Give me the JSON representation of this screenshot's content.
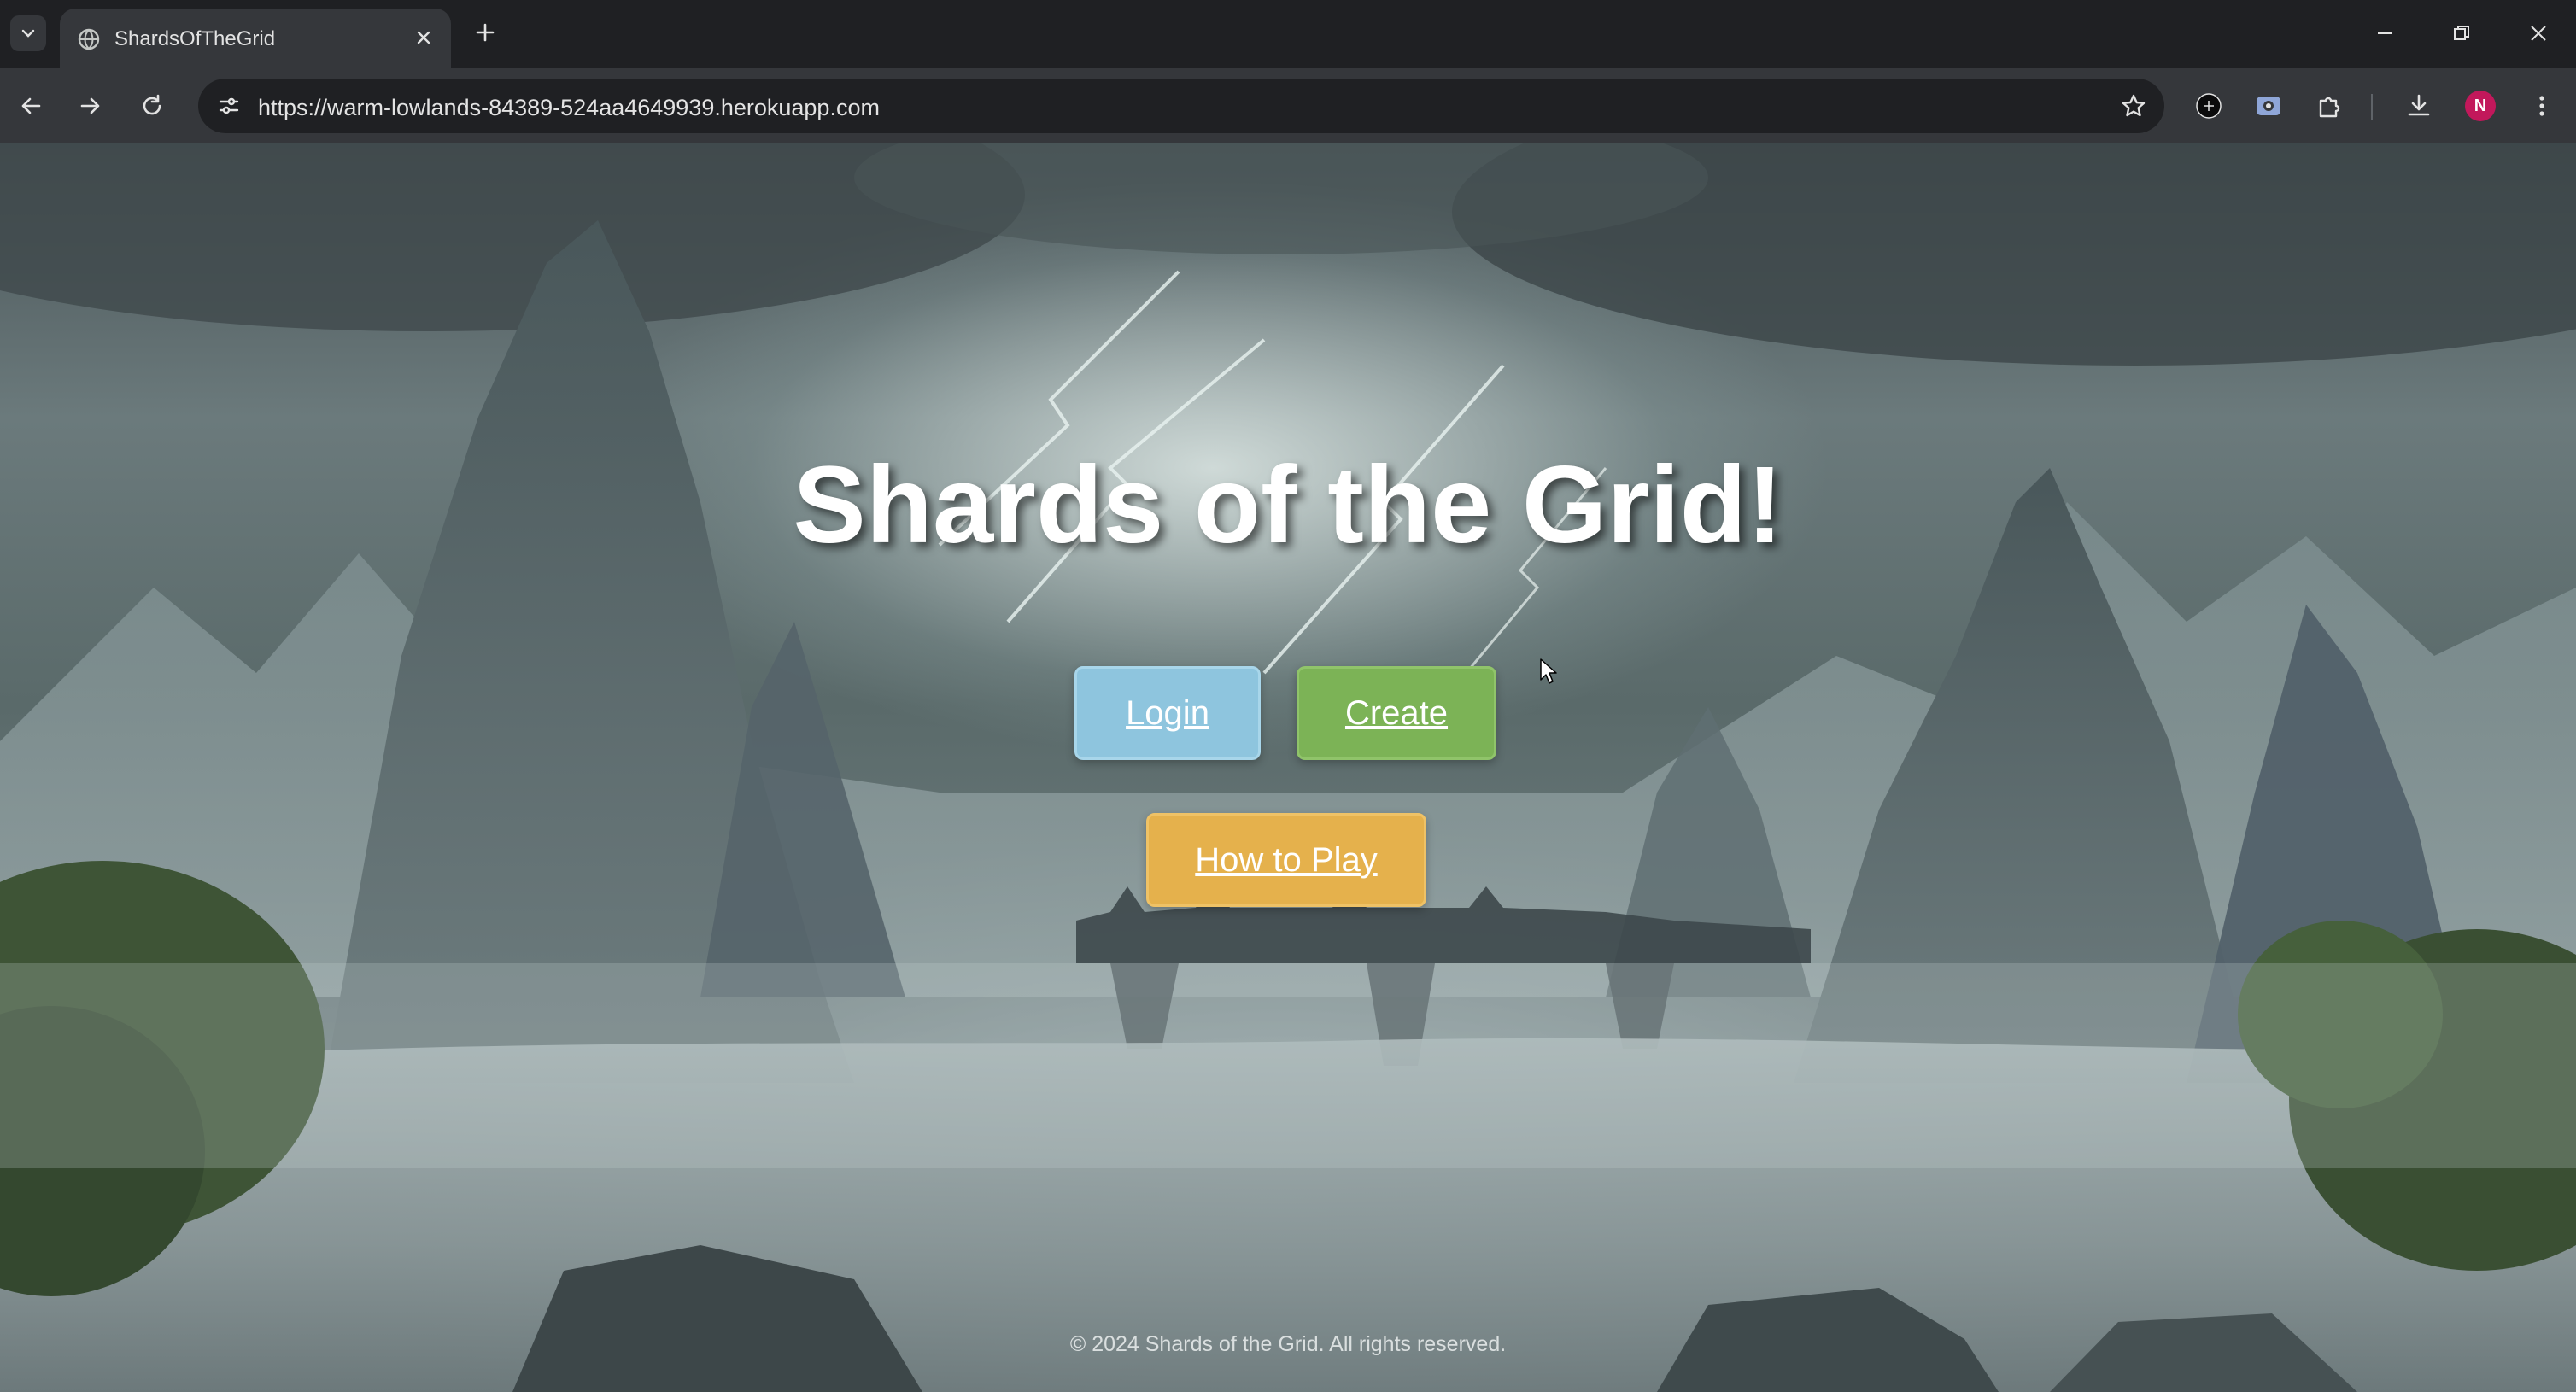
{
  "browser": {
    "tab": {
      "title": "ShardsOfTheGrid"
    },
    "url": "https://warm-lowlands-84389-524aa4649939.herokuapp.com",
    "profile_initial": "N"
  },
  "page": {
    "title": "Shards of the Grid!",
    "buttons": {
      "login": "Login",
      "create": "Create",
      "how_to_play": "How to Play"
    },
    "footer": "© 2024 Shards of the Grid. All rights reserved."
  },
  "colors": {
    "login_button": "#8ec5de",
    "create_button": "#7cb356",
    "how_to_play_button": "#e5b14c",
    "browser_frame": "#1f2023",
    "browser_toolbar": "#35373b"
  }
}
